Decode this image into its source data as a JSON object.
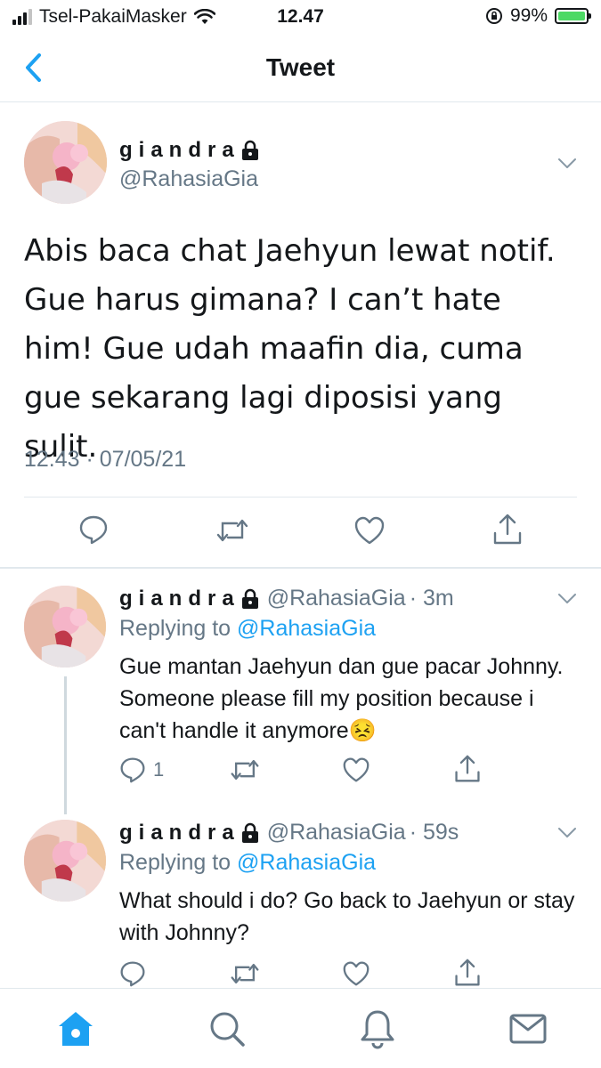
{
  "status_bar": {
    "carrier": "Tsel-PakaiMasker",
    "time": "12.47",
    "battery": "99%"
  },
  "nav": {
    "title": "Tweet"
  },
  "main_tweet": {
    "display_name": "giandra",
    "handle": "@RahasiaGia",
    "text": "Abis baca chat Jaehyun lewat notif. Gue harus gimana? I can’t hate him! Gue udah maafin dia, cuma gue sekarang lagi diposisi yang sulit.",
    "timestamp": "12.43 · 07/05/21"
  },
  "replies": [
    {
      "display_name": "giandra",
      "handle": "@RahasiaGia",
      "time": "· 3m",
      "replying_label": "Replying to",
      "replying_handle": "@RahasiaGia",
      "text": "Gue mantan Jaehyun dan gue pacar Johnny. Someone please fill my position because i can't handle it anymore😣",
      "reply_count": "1"
    },
    {
      "display_name": "giandra",
      "handle": "@RahasiaGia",
      "time": "· 59s",
      "replying_label": "Replying to",
      "replying_handle": "@RahasiaGia",
      "text": "What should i do? Go back to Jaehyun or stay with Johnny?",
      "reply_count": ""
    }
  ],
  "colors": {
    "accent": "#1da1f2",
    "secondary_text": "#657786",
    "divider": "#e1e8ed",
    "battery_fill": "#4cd964"
  },
  "tab_bar": {
    "items": [
      "home-icon",
      "search-icon",
      "notifications-icon",
      "messages-icon"
    ],
    "active": "home-icon"
  }
}
